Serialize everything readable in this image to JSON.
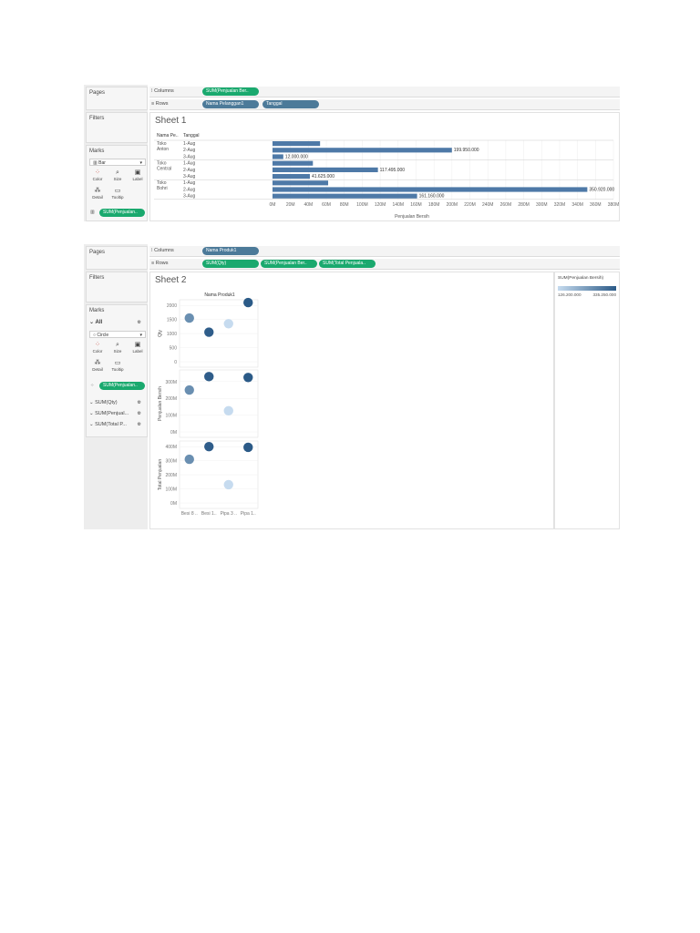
{
  "shot1": {
    "pages_label": "Pages",
    "filters_label": "Filters",
    "marks_label": "Marks",
    "mark_type": "Bar",
    "mark_buttons": [
      "Color",
      "Size",
      "Label",
      "Detail",
      "Tooltip"
    ],
    "marks_pill": "SUM(Penjualan..",
    "columns_label": "Columns",
    "rows_label": "Rows",
    "columns_pills": [
      "SUM(Penjualan Ber.."
    ],
    "rows_pills": [
      "Nama Pelanggan1",
      "Tanggal"
    ],
    "sheet_title": "Sheet 1",
    "header_customer": "Nama Pe..",
    "header_date": "Tanggal"
  },
  "shot2": {
    "pages_label": "Pages",
    "filters_label": "Filters",
    "marks_label": "Marks",
    "all_label": "All",
    "mark_type": "Circle",
    "mark_buttons": [
      "Color",
      "Size",
      "Label",
      "Detail",
      "Tooltip"
    ],
    "marks_pill": "SUM(Penjualan..",
    "measure_cards": [
      "SUM(Qty)",
      "SUM(Penjual...",
      "SUM(Total P..."
    ],
    "columns_label": "Columns",
    "rows_label": "Rows",
    "columns_pills": [
      "Nama Produk1"
    ],
    "rows_pills": [
      "SUM(Qty)",
      "SUM(Penjualan Ber..",
      "SUM(Total Penjuala.."
    ],
    "sheet_title": "Sheet 2",
    "header": "Nama Produk1",
    "legend_title": "SUM(Penjualan Bersih)",
    "legend_min": "126.200.000",
    "legend_max": "335.250.000",
    "legend_colors": [
      "#c6dbef",
      "#2b5a87"
    ]
  },
  "chart_data": [
    {
      "type": "bar",
      "title": "Sheet 1",
      "xlabel": "Penjualan Bersih",
      "groups": [
        "Toko Anton",
        "Toko Central",
        "Toko Bohri"
      ],
      "categories": [
        "1-Aug",
        "2-Aug",
        "3-Aug"
      ],
      "rows": [
        {
          "group": "Toko Anton",
          "date": "1-Aug",
          "value": 53000000,
          "label": ""
        },
        {
          "group": "Toko Anton",
          "date": "2-Aug",
          "value": 199950000,
          "label": "199.950.000"
        },
        {
          "group": "Toko Anton",
          "date": "3-Aug",
          "value": 12000000,
          "label": "12.000.000"
        },
        {
          "group": "Toko Central",
          "date": "1-Aug",
          "value": 45000000,
          "label": ""
        },
        {
          "group": "Toko Central",
          "date": "2-Aug",
          "value": 117495000,
          "label": "117.495.000"
        },
        {
          "group": "Toko Central",
          "date": "3-Aug",
          "value": 41625000,
          "label": "41.625.000"
        },
        {
          "group": "Toko Bohri",
          "date": "1-Aug",
          "value": 62000000,
          "label": ""
        },
        {
          "group": "Toko Bohri",
          "date": "2-Aug",
          "value": 350920000,
          "label": "350.920.000"
        },
        {
          "group": "Toko Bohri",
          "date": "3-Aug",
          "value": 161160000,
          "label": "161.160.000"
        }
      ],
      "xticks": [
        "0M",
        "20M",
        "40M",
        "60M",
        "80M",
        "100M",
        "120M",
        "140M",
        "160M",
        "180M",
        "200M",
        "220M",
        "240M",
        "260M",
        "280M",
        "300M",
        "320M",
        "340M",
        "360M",
        "380M"
      ],
      "xlim": [
        0,
        380000000
      ],
      "bar_color": "#4e79a7",
      "grid": true
    },
    {
      "type": "scatter",
      "title": "Sheet 2",
      "categories": [
        "Besi 8 ..",
        "Besi 1..",
        "Pipa 3 ..",
        "Pipa 1.."
      ],
      "panels": [
        {
          "ylabel": "Qty",
          "yticks": [
            "0",
            "500",
            "1000",
            "1500",
            "2000"
          ],
          "ylim": [
            0,
            2200
          ],
          "values": [
            1550,
            1050,
            1350,
            2100
          ]
        },
        {
          "ylabel": "Penjualan Bersih",
          "yticks": [
            "0M",
            "100M",
            "200M",
            "300M"
          ],
          "ylim": [
            0,
            370000000
          ],
          "values": [
            250000000,
            330000000,
            126000000,
            325000000
          ]
        },
        {
          "ylabel": "Total Penjualan",
          "yticks": [
            "0M",
            "100M",
            "200M",
            "300M",
            "400M"
          ],
          "ylim": [
            0,
            440000000
          ],
          "values": [
            310000000,
            400000000,
            130000000,
            395000000
          ]
        }
      ],
      "color_values": [
        250000000,
        330000000,
        126200000,
        335250000
      ],
      "color_range": [
        126200000,
        335250000
      ],
      "grid": true
    }
  ]
}
